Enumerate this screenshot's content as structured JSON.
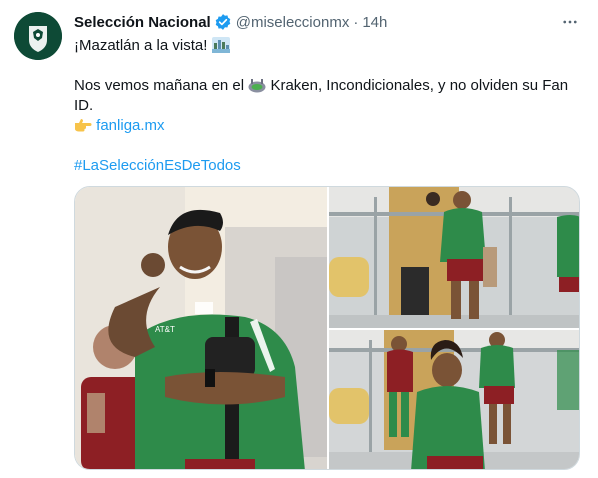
{
  "account": {
    "name": "Selección Nacional",
    "handle": "@miseleccionmx",
    "separator": "·",
    "time": "14h"
  },
  "tweet": {
    "line1": "¡Mazatlán a la vista!",
    "line2_part1": "Nos vemos mañana en el",
    "line2_part2": "Kraken, Incondicionales, y no olviden su Fan",
    "line3": "ID.",
    "link": "fanliga.mx",
    "hashtag": "#LaSelecciónEsDeTodos"
  },
  "icons": {
    "verified": "verified-badge-icon",
    "more": "more-options-icon",
    "emoji1": "city-skyline-emoji",
    "emoji2": "stadium-emoji",
    "emoji3": "pointing-right-emoji"
  },
  "media": {
    "photo_count": 3,
    "photo_jersey_sponsor": "AT&T"
  },
  "colors": {
    "link": "#1d9bf0",
    "secondary_text": "#536471",
    "jersey_green": "#2e8b4a",
    "verified_blue": "#1d9bf0",
    "avatar_bg": "#0e4a36"
  }
}
